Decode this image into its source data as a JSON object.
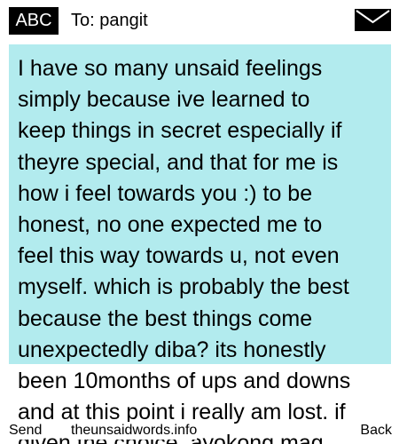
{
  "header": {
    "input_mode": "ABC",
    "recipient": "To: pangit",
    "mail_icon": "envelope-icon"
  },
  "message": {
    "background_color": "#b2ebee",
    "text": "I have so many unsaid feelings\nsimply because ive learned to\nkeep things in secret especially if\ntheyre special, and that for me is\nhow i feel towards you :) to be\nhonest, no one expected me to\nfeel this way towards u, not even\nmyself. which is probably the best\nbecause the best things come\nunexpectedly diba? its honestly\nbeen 10months of ups and downs\nand at this point i really am lost. if\ngiven the choice, ayokong mag"
  },
  "footer": {
    "left_softkey": "Send",
    "center_text": "theunsaidwords.info",
    "right_softkey": "Back"
  }
}
